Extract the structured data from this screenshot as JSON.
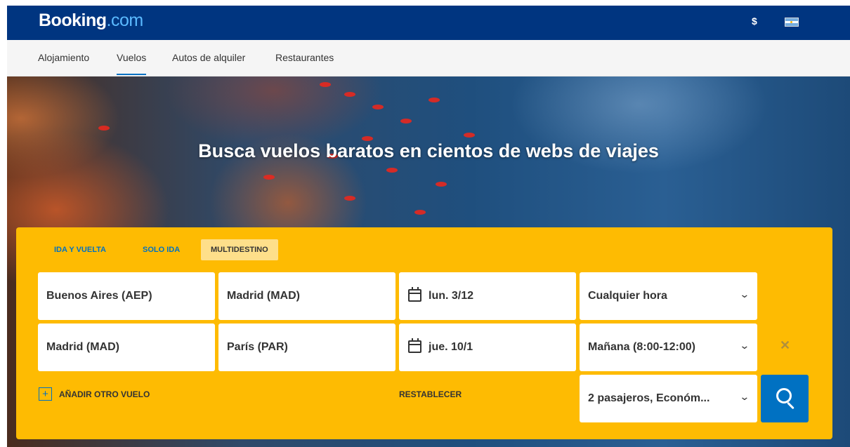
{
  "header": {
    "logo_main": "Booking",
    "logo_suffix": ".com",
    "currency": "$",
    "flag_icon": "argentina-flag-icon"
  },
  "nav": {
    "items": [
      {
        "label": "Alojamiento",
        "active": false
      },
      {
        "label": "Vuelos",
        "active": true
      },
      {
        "label": "Autos de alquiler",
        "active": false
      },
      {
        "label": "Restaurantes",
        "active": false
      }
    ]
  },
  "hero": {
    "title": "Busca vuelos baratos en cientos de webs de viajes"
  },
  "search": {
    "trip_types": [
      {
        "label": "IDA Y VUELTA",
        "active": false
      },
      {
        "label": "SOLO IDA",
        "active": false
      },
      {
        "label": "MULTIDESTINO",
        "active": true
      }
    ],
    "legs": [
      {
        "origin": "Buenos Aires (AEP)",
        "destination": "Madrid (MAD)",
        "date": "lun. 3/12",
        "time": "Cualquier hora"
      },
      {
        "origin": "Madrid (MAD)",
        "destination": "París (PAR)",
        "date": "jue. 10/1",
        "time": "Mañana (8:00-12:00)"
      }
    ],
    "add_flight_label": "AÑADIR OTRO VUELO",
    "reset_label": "RESTABLECER",
    "passengers": "2 pasajeros, Económ...",
    "remove_glyph": "✕",
    "add_glyph": "+",
    "chevron_glyph": "⌄"
  },
  "colors": {
    "brand_blue": "#003580",
    "accent_blue": "#0071c2",
    "search_yellow": "#febb02"
  }
}
